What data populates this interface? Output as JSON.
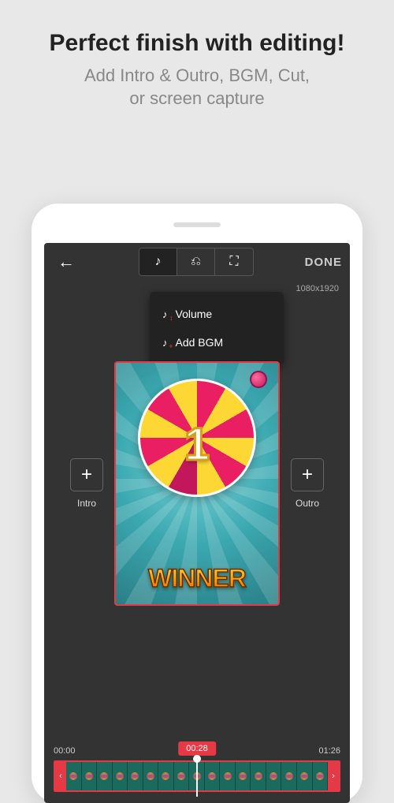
{
  "promo": {
    "title": "Perfect finish with editing!",
    "subtitle_line1": "Add Intro & Outro, BGM, Cut,",
    "subtitle_line2": "or screen capture"
  },
  "topbar": {
    "done_label": "DONE",
    "resolution": "1080x1920"
  },
  "dropdown": {
    "volume_label": "Volume",
    "bgm_label": "Add BGM"
  },
  "slots": {
    "intro_label": "Intro",
    "outro_label": "Outro"
  },
  "preview": {
    "number": "1",
    "banner": "WINNER"
  },
  "timeline": {
    "start": "00:00",
    "current": "00:28",
    "end": "01:26"
  }
}
